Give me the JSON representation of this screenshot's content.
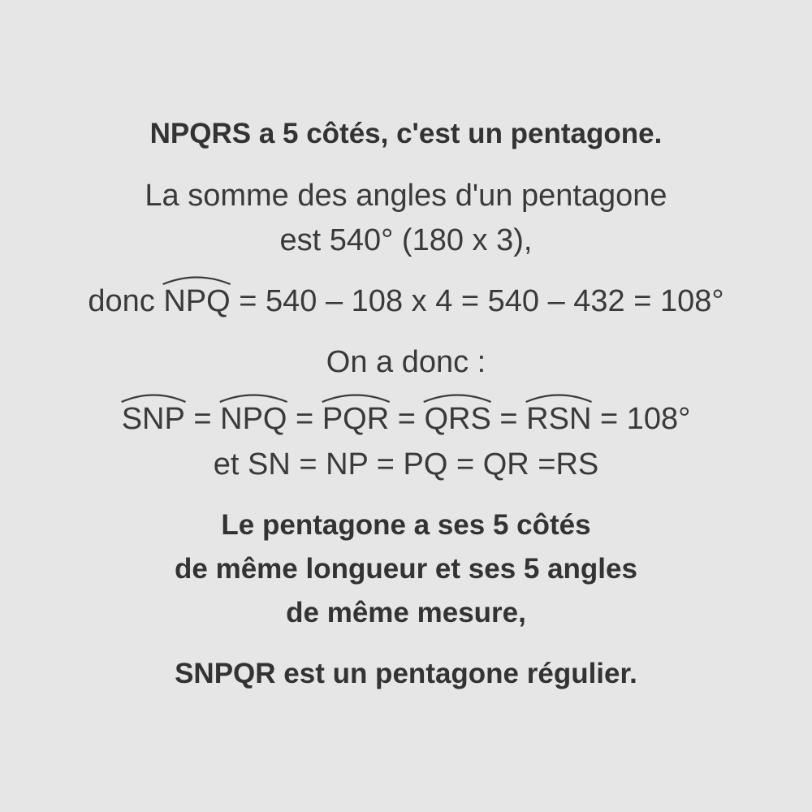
{
  "heading": "NPQRS a 5 côtés, c'est un pentagone.",
  "sum_line_1": "La somme des angles d'un pentagone",
  "sum_line_2": "est 540° (180 x 3),",
  "calc": {
    "prefix": "donc ",
    "angle": "NPQ",
    "expression": " = 540 – 108 x 4 = 540 – 432 = 108°"
  },
  "on_a_donc": "On a donc :",
  "angles_equality": {
    "angles": [
      "SNP",
      "NPQ",
      "PQR",
      "QRS",
      "RSN"
    ],
    "separator": " = ",
    "result": " = 108°"
  },
  "sides_equality": "et SN = NP = PQ = QR =RS",
  "conclusion_lines": [
    "Le pentagone a ses 5 côtés",
    "de même longueur et ses 5 angles",
    "de même mesure,"
  ],
  "final_statement": "SNPQR est un pentagone régulier."
}
